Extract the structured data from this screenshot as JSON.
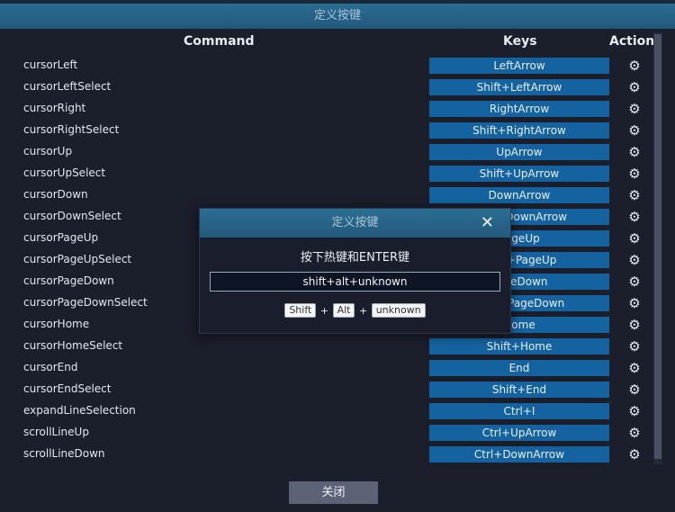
{
  "window": {
    "title": "定义按键"
  },
  "headers": {
    "command": "Command",
    "keys": "Keys",
    "action": "Action"
  },
  "rows": [
    {
      "command": "cursorLeft",
      "key": "LeftArrow"
    },
    {
      "command": "cursorLeftSelect",
      "key": "Shift+LeftArrow"
    },
    {
      "command": "cursorRight",
      "key": "RightArrow"
    },
    {
      "command": "cursorRightSelect",
      "key": "Shift+RightArrow"
    },
    {
      "command": "cursorUp",
      "key": "UpArrow"
    },
    {
      "command": "cursorUpSelect",
      "key": "Shift+UpArrow"
    },
    {
      "command": "cursorDown",
      "key": "DownArrow"
    },
    {
      "command": "cursorDownSelect",
      "key": "Shift+DownArrow"
    },
    {
      "command": "cursorPageUp",
      "key": "PageUp"
    },
    {
      "command": "cursorPageUpSelect",
      "key": "Shift+PageUp"
    },
    {
      "command": "cursorPageDown",
      "key": "PageDown"
    },
    {
      "command": "cursorPageDownSelect",
      "key": "Shift+PageDown"
    },
    {
      "command": "cursorHome",
      "key": "Home"
    },
    {
      "command": "cursorHomeSelect",
      "key": "Shift+Home"
    },
    {
      "command": "cursorEnd",
      "key": "End"
    },
    {
      "command": "cursorEndSelect",
      "key": "Shift+End"
    },
    {
      "command": "expandLineSelection",
      "key": "Ctrl+I"
    },
    {
      "command": "scrollLineUp",
      "key": "Ctrl+UpArrow"
    },
    {
      "command": "scrollLineDown",
      "key": "Ctrl+DownArrow"
    }
  ],
  "action_icon": "gear-icon",
  "close_button": "关闭",
  "modal": {
    "title": "定义按键",
    "close_glyph": "✕",
    "prompt": "按下热键和ENTER键",
    "input_value": "shift+alt+unknown",
    "chips": [
      "Shift",
      "Alt",
      "unknown"
    ],
    "separator": "+"
  },
  "colors": {
    "titlebar": "#215879",
    "key_button": "#1463a0",
    "background": "#1b1e2b",
    "close_button": "#5e6277"
  }
}
